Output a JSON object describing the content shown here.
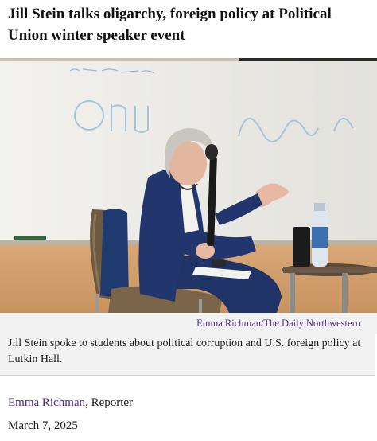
{
  "article": {
    "headline": "Jill Stein talks oligarchy, foreign policy at Political Union winter speaker event",
    "photo_credit": "Emma Richman/The Daily Northwestern",
    "caption": "Jill Stein spoke to students about political corruption and U.S. foreign policy at Lutkin Hall.",
    "author": "Emma Richman",
    "author_role": ", Reporter",
    "date": "March 7, 2025"
  },
  "colors": {
    "accent_purple": "#4e2a84",
    "caption_background": "#f2f2f2",
    "text": "#1a1a1a"
  }
}
